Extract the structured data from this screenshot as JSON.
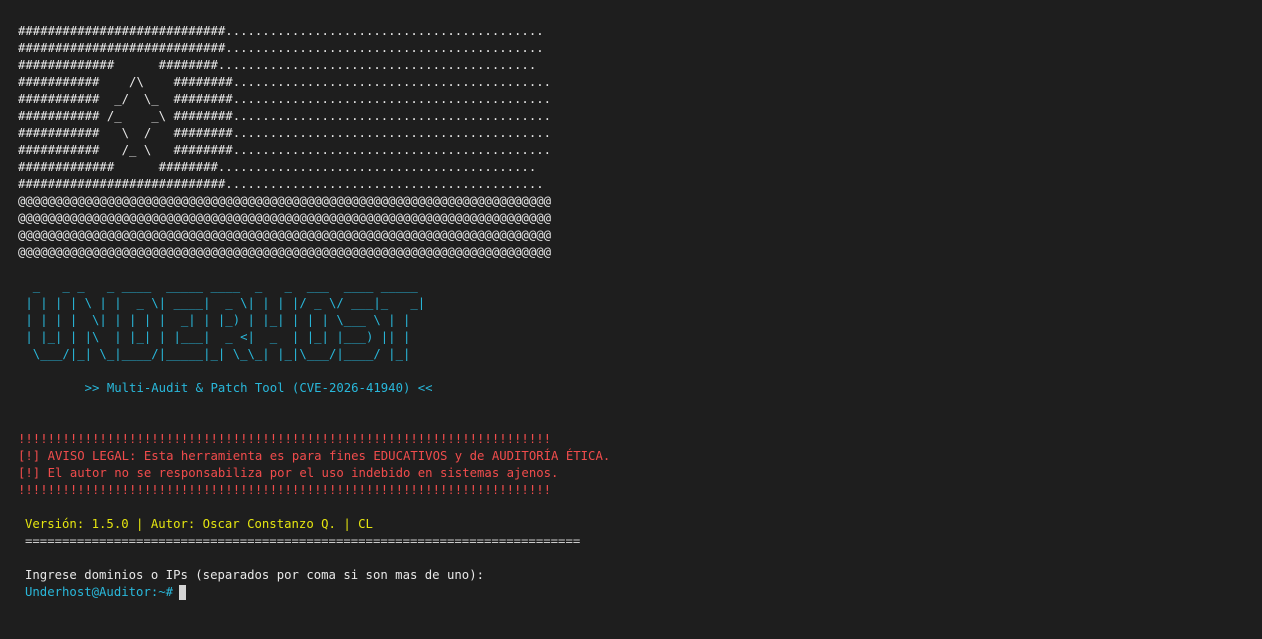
{
  "logo_lines": [
    "############################...........................................",
    "############################...........................................",
    "#############      ########...........................................",
    "###########    /\\    ########...........................................",
    "###########  _/  \\_  ########...........................................",
    "########### /_    _\\ ########...........................................",
    "###########   \\  /   ########...........................................",
    "###########   /_ \\   ########...........................................",
    "#############      ########...........................................",
    "############################...........................................",
    "@@@@@@@@@@@@@@@@@@@@@@@@@@@@@@@@@@@@@@@@@@@@@@@@@@@@@@@@@@@@@@@@@@@@@@@@",
    "@@@@@@@@@@@@@@@@@@@@@@@@@@@@@@@@@@@@@@@@@@@@@@@@@@@@@@@@@@@@@@@@@@@@@@@@",
    "@@@@@@@@@@@@@@@@@@@@@@@@@@@@@@@@@@@@@@@@@@@@@@@@@@@@@@@@@@@@@@@@@@@@@@@@",
    "@@@@@@@@@@@@@@@@@@@@@@@@@@@@@@@@@@@@@@@@@@@@@@@@@@@@@@@@@@@@@@@@@@@@@@@@"
  ],
  "banner_lines": [
    "  _   _ _   _ ____  _____ ____  _   _  ___  ____ _____ ",
    " | | | | \\ | |  _ \\| ____|  _ \\| | | |/ _ \\/ ___|_   _|",
    " | | | |  \\| | | | |  _| | |_) | |_| | | | \\___ \\ | |  ",
    " | |_| | |\\  | |_| | |___|  _ <|  _  | |_| |___) || |  ",
    "  \\___/|_| \\_|____/|_____|_| \\_\\_| |_|\\___/|____/ |_|  "
  ],
  "tagline": "         >> Multi-Audit & Patch Tool (CVE-2026-41940) <<",
  "warning": {
    "border_top": "!!!!!!!!!!!!!!!!!!!!!!!!!!!!!!!!!!!!!!!!!!!!!!!!!!!!!!!!!!!!!!!!!!!!!!!!",
    "line1": "[!] AVISO LEGAL: Esta herramienta es para fines EDUCATIVOS y de AUDITORÍA ÉTICA.",
    "line2": "[!] El autor no se responsabiliza por el uso indebido en sistemas ajenos.",
    "border_bottom": "!!!!!!!!!!!!!!!!!!!!!!!!!!!!!!!!!!!!!!!!!!!!!!!!!!!!!!!!!!!!!!!!!!!!!!!!"
  },
  "version_line": "Versión: 1.5.0 | Autor: Oscar Constanzo Q. | CL",
  "rule": "===========================================================================",
  "prompt_label": "Ingrese dominios o IPs (separados por coma si son mas de uno):",
  "prompt": "Underhost@Auditor:~#",
  "colors": {
    "background": "#1e1e1e",
    "cyan": "#29b8db",
    "red": "#f14c4c",
    "yellow": "#e5e510"
  }
}
